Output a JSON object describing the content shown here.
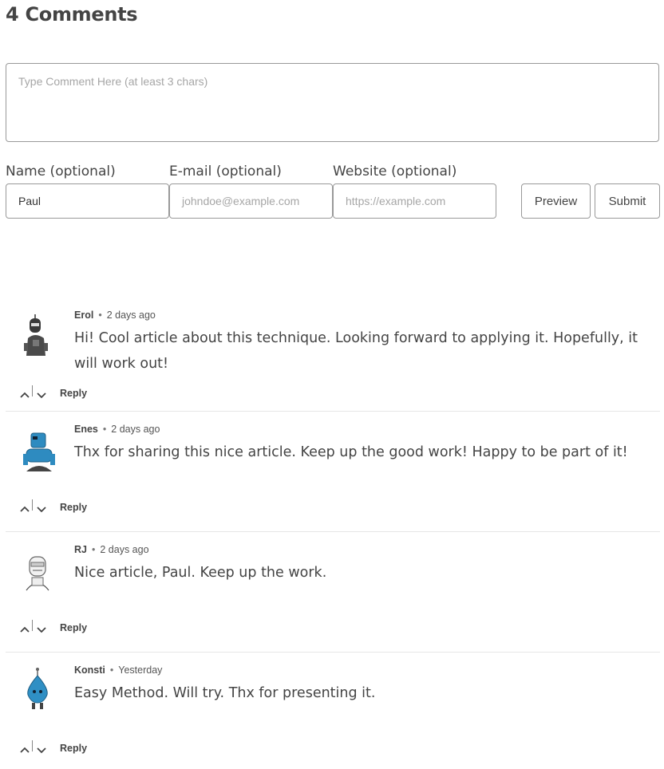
{
  "header": {
    "title": "4 Comments"
  },
  "form": {
    "comment_placeholder": "Type Comment Here (at least 3 chars)",
    "name_label": "Name (optional)",
    "name_value": "Paul",
    "email_label": "E-mail (optional)",
    "email_placeholder": "johndoe@example.com",
    "website_label": "Website (optional)",
    "website_placeholder": "https://example.com",
    "preview_label": "Preview",
    "submit_label": "Submit"
  },
  "comments": [
    {
      "author": "Erol",
      "separator": "•",
      "time": "2 days ago",
      "text": "Hi! Cool article about this technique. Looking forward to applying it. Hopefully, it will work out!",
      "reply_label": "Reply",
      "avatar": "robot-avatar-dark",
      "avatar_color": "#3a3a3a"
    },
    {
      "author": "Enes",
      "separator": "•",
      "time": "2 days ago",
      "text": "Thx for sharing this nice article. Keep up the good work! Happy to be part of it!",
      "reply_label": "Reply",
      "avatar": "robot-avatar-blue",
      "avatar_color": "#2e8bc0"
    },
    {
      "author": "RJ",
      "separator": "•",
      "time": "2 days ago",
      "text": "Nice article, Paul. Keep up the work.",
      "reply_label": "Reply",
      "avatar": "robot-avatar-sketch",
      "avatar_color": "#9a9a9a"
    },
    {
      "author": "Konsti",
      "separator": "•",
      "time": "Yesterday",
      "text": "Easy Method. Will try. Thx for presenting it.",
      "reply_label": "Reply",
      "avatar": "robot-avatar-drop",
      "avatar_color": "#2f8fc4"
    }
  ]
}
